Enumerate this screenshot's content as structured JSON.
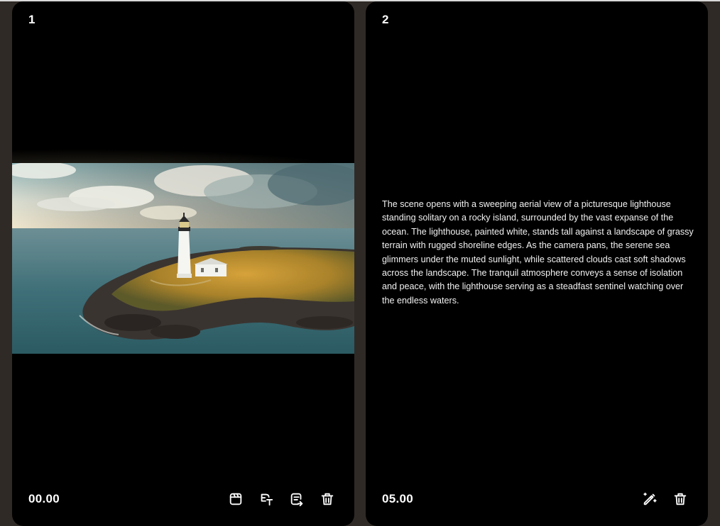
{
  "scenes": [
    {
      "number": "1",
      "time": "00.00",
      "toolbar": [
        "clapperboard-icon",
        "translate-icon",
        "caption-icon",
        "trash-icon"
      ]
    },
    {
      "number": "2",
      "time": "05.00",
      "description": "The scene opens with a sweeping aerial view of a picturesque lighthouse standing solitary on a rocky island, surrounded by the vast expanse of the ocean. The lighthouse, painted white, stands tall against a landscape of grassy terrain with rugged shoreline edges. As the camera pans, the serene sea glimmers under the muted sunlight, while scattered clouds cast soft shadows across the landscape. The tranquil atmosphere conveys a sense of isolation and peace, with the lighthouse serving as a steadfast sentinel watching over the endless waters.",
      "toolbar": [
        "magic-edit-icon",
        "trash-icon"
      ]
    }
  ],
  "colors": {
    "background": "#2f2a26",
    "card": "#000000",
    "text": "#ffffff"
  }
}
